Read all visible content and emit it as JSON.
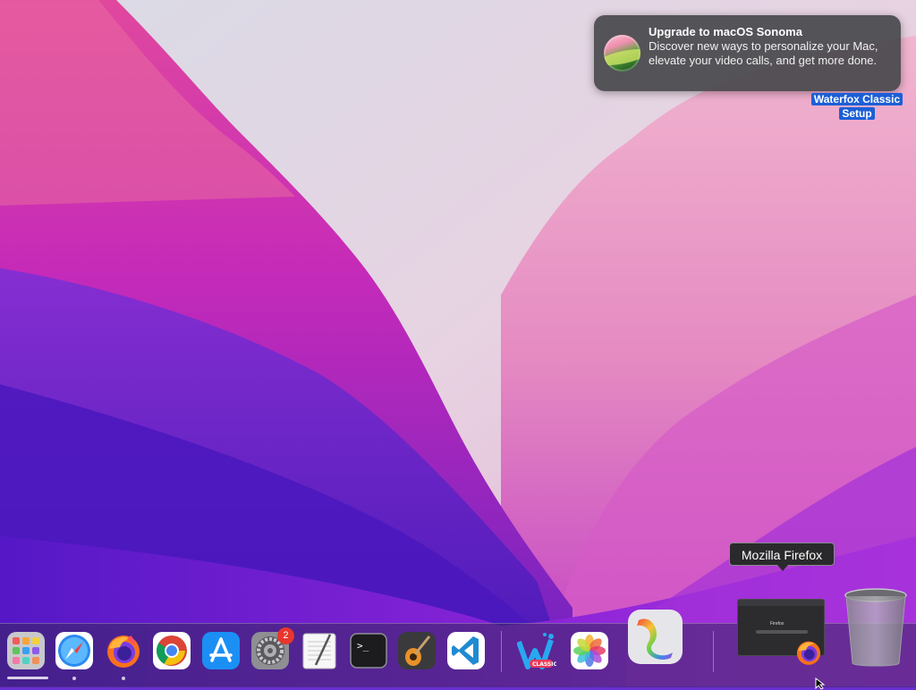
{
  "notification": {
    "title": "Upgrade to macOS Sonoma",
    "body": "Discover new ways to personalize your Mac, elevate your video calls, and get more done."
  },
  "desktop": {
    "icon_label_line1": "Waterfox Classic",
    "icon_label_line2": "Setup"
  },
  "tooltip": {
    "text": "Mozilla Firefox"
  },
  "dock": {
    "items": [
      {
        "name": "Launchpad",
        "icon": "launchpad-icon",
        "running": false
      },
      {
        "name": "Safari",
        "icon": "safari-icon",
        "running": true
      },
      {
        "name": "Firefox",
        "icon": "firefox-icon",
        "running": true
      },
      {
        "name": "Google Chrome",
        "icon": "chrome-icon",
        "running": false
      },
      {
        "name": "App Store",
        "icon": "app-store-icon",
        "running": false
      },
      {
        "name": "System Preferences",
        "icon": "system-preferences-icon",
        "running": false,
        "badge": "2"
      },
      {
        "name": "TextEdit",
        "icon": "textedit-icon",
        "running": false
      },
      {
        "name": "Terminal",
        "icon": "terminal-icon",
        "running": false
      },
      {
        "name": "GarageBand",
        "icon": "garageband-icon",
        "running": false
      },
      {
        "name": "Visual Studio Code",
        "icon": "vscode-icon",
        "running": false
      },
      {
        "name": "Waterfox Classic",
        "icon": "waterfox-classic-icon",
        "running": false
      },
      {
        "name": "Photos",
        "icon": "photos-icon",
        "running": false
      },
      {
        "name": "Grapher",
        "icon": "grapher-icon",
        "running": false
      },
      {
        "name": "Mozilla Firefox window",
        "icon": "minimized-firefox-window-icon",
        "running": false
      },
      {
        "name": "Trash",
        "icon": "trash-icon",
        "running": false
      }
    ],
    "system_preferences_badge": "2",
    "mini_window_text": "Firefox"
  },
  "colors": {
    "notification_bg": "#48484c",
    "label_highlight": "#1c5fd6",
    "badge_red": "#e8362d"
  }
}
